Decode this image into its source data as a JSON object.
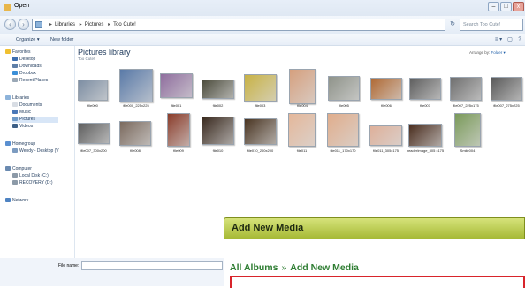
{
  "window": {
    "title": "Open",
    "controls": [
      "–",
      "□",
      "x"
    ]
  },
  "nav": {
    "back": "‹",
    "forward": "›",
    "breadcrumbs": [
      "Libraries",
      "Pictures",
      "Too Cute!"
    ],
    "search_placeholder": "Search Too Cute!"
  },
  "toolbar": {
    "organize": "Organize ▾",
    "new_folder": "New folder",
    "views_icon": "≡ ▾",
    "preview_icon": "▢",
    "help_icon": "?"
  },
  "sidebar": {
    "favorites": {
      "label": "Favorites",
      "items": [
        "Desktop",
        "Downloads",
        "Dropbox",
        "Recent Places"
      ]
    },
    "libraries": {
      "label": "Libraries",
      "items": [
        "Documents",
        "Music",
        "Pictures",
        "Videos"
      ]
    },
    "homegroup": {
      "label": "Homegroup",
      "items": [
        "Wendy - Desktop (V"
      ]
    },
    "computer": {
      "label": "Computer",
      "items": [
        "Local Disk (C:)",
        "RECOVERY (D:)"
      ]
    },
    "network": {
      "label": "Network"
    }
  },
  "library": {
    "title": "Pictures library",
    "subtitle": "Too Cute!",
    "arrange_label": "Arrange by:",
    "arrange_value": "Folder ▾"
  },
  "thumbnails_row1": [
    {
      "label": "file000",
      "color": "#7d8ea3"
    },
    {
      "label": "file000_225x225",
      "color": "#5a7aa8"
    },
    {
      "label": "file001",
      "color": "#8f6e9e"
    },
    {
      "label": "file002",
      "color": "#4d4d3d"
    },
    {
      "label": "file003",
      "color": "#c8b245"
    },
    {
      "label": "file004",
      "color": "#d6a07e"
    },
    {
      "label": "file005",
      "color": "#8f938a"
    },
    {
      "label": "file006",
      "color": "#b06a35"
    },
    {
      "label": "file007",
      "color": "#5f5f5f"
    },
    {
      "label": "file007_225x175",
      "color": "#6f6f6f"
    },
    {
      "label": "file007_275x225",
      "color": "#5a5a5a"
    }
  ],
  "thumbnails_row2": [
    {
      "label": "file007_300x200",
      "color": "#5f5f5f"
    },
    {
      "label": "file008",
      "color": "#7b6a5e"
    },
    {
      "label": "file009",
      "color": "#8a3c2a"
    },
    {
      "label": "file010",
      "color": "#3a2a1f"
    },
    {
      "label": "file010_200x200",
      "color": "#4a3522"
    },
    {
      "label": "file011",
      "color": "#e4b79a"
    },
    {
      "label": "file011_170x170",
      "color": "#e0ad8c"
    },
    {
      "label": "file011_305x175",
      "color": "#deb09a"
    },
    {
      "label": "headerImage_305 x175",
      "color": "#4a2d1e"
    },
    {
      "label": "Smile004",
      "color": "#7a9a5a"
    }
  ],
  "file_name_label": "File name:",
  "wp": {
    "header": "Add New Media",
    "crumb_root": "All Albums",
    "crumb_sep": "»",
    "crumb_current": "Add New Media"
  }
}
